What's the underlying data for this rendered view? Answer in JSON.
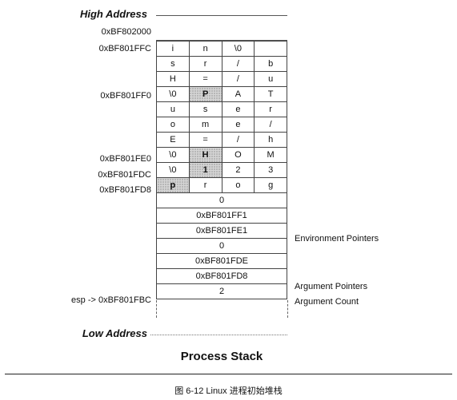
{
  "header": {
    "high_address": "High Address",
    "low_address": "Low Address"
  },
  "top_address": "0xBF802000",
  "stack_rows": [
    {
      "address": "0xBF801FFC",
      "cells": [
        "i",
        "n",
        "\\0",
        ""
      ],
      "shaded": []
    },
    {
      "address": "",
      "cells": [
        "s",
        "r",
        "/",
        "b"
      ],
      "shaded": []
    },
    {
      "address": "",
      "cells": [
        "H",
        "=",
        "/",
        "u"
      ],
      "shaded": []
    },
    {
      "address": "0xBF801FF0",
      "cells": [
        "\\0",
        "P",
        "A",
        "T"
      ],
      "shaded": [
        1
      ]
    },
    {
      "address": "",
      "cells": [
        "u",
        "s",
        "e",
        "r"
      ],
      "shaded": []
    },
    {
      "address": "",
      "cells": [
        "o",
        "m",
        "e",
        "/"
      ],
      "shaded": []
    },
    {
      "address": "",
      "cells": [
        "E",
        "=",
        "/",
        "h"
      ],
      "shaded": []
    },
    {
      "address": "0xBF801FE0",
      "cells": [
        "\\0",
        "H",
        "O",
        "M"
      ],
      "shaded": [
        1
      ]
    },
    {
      "address": "0xBF801FDC",
      "cells": [
        "\\0",
        "1",
        "2",
        "3"
      ],
      "shaded": [
        1
      ]
    },
    {
      "address": "0xBF801FD8",
      "cells": [
        "p",
        "r",
        "o",
        "g"
      ],
      "shaded": [
        0
      ]
    },
    {
      "address": "",
      "value": "0",
      "right_label": ""
    },
    {
      "address": "",
      "value": "0xBF801FF1",
      "right_label": ""
    },
    {
      "address": "",
      "value": "0xBF801FE1",
      "right_label": "Environment Pointers"
    },
    {
      "address": "",
      "value": "0",
      "right_label": ""
    },
    {
      "address": "",
      "value": "0xBF801FDE",
      "right_label": ""
    },
    {
      "address": "",
      "value": "0xBF801FD8",
      "right_label": "Argument Pointers"
    },
    {
      "address": "esp ->  0xBF801FBC",
      "value": "2",
      "right_label": "Argument Count"
    }
  ],
  "title": "Process Stack",
  "caption": "图 6-12   Linux 进程初始堆栈"
}
